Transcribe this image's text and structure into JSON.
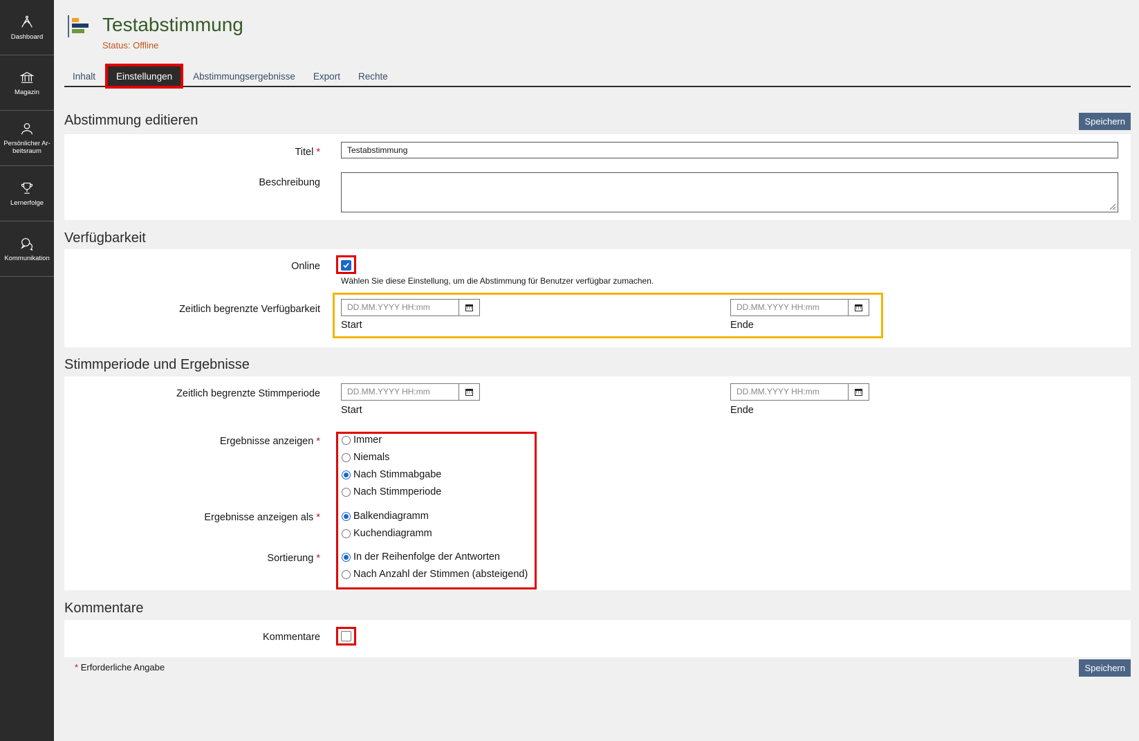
{
  "sidebar": {
    "items": [
      {
        "label": "Dashboard",
        "icon": "dashboard-icon"
      },
      {
        "label": "Magazin",
        "icon": "bank-icon"
      },
      {
        "label": "Persönlicher Ar-beitsraum",
        "icon": "user-icon"
      },
      {
        "label": "Lernerfolge",
        "icon": "trophy-icon"
      },
      {
        "label": "Kommunikation",
        "icon": "chat-icon"
      }
    ]
  },
  "header": {
    "title": "Testabstimmung",
    "status": "Status: Offline"
  },
  "tabs": [
    {
      "label": "Inhalt",
      "active": false
    },
    {
      "label": "Einstellungen",
      "active": true
    },
    {
      "label": "Abstimmungsergebnisse",
      "active": false
    },
    {
      "label": "Export",
      "active": false
    },
    {
      "label": "Rechte",
      "active": false
    }
  ],
  "buttons": {
    "save": "Speichern"
  },
  "sections": {
    "edit": "Abstimmung editieren",
    "availability": "Verfügbarkeit",
    "period": "Stimmperiode und Ergebnisse",
    "comments": "Kommentare"
  },
  "form": {
    "title_label": "Titel",
    "title_value": "Testabstimmung",
    "description_label": "Beschreibung",
    "online_label": "Online",
    "online_checked": true,
    "online_help": "Wählen Sie diese Einstellung, um die Abstimmung für Benutzer verfügbar zumachen.",
    "limited_availability_label": "Zeitlich begrenzte Verfügbarkeit",
    "limited_period_label": "Zeitlich begrenzte Stimmperiode",
    "date_placeholder": "DD.MM.YYYY HH:mm",
    "start_label": "Start",
    "end_label": "Ende",
    "show_results_label": "Ergebnisse anzeigen",
    "show_results_options": [
      "Immer",
      "Niemals",
      "Nach Stimmabgabe",
      "Nach Stimmperiode"
    ],
    "show_results_selected": "Nach Stimmabgabe",
    "show_as_label": "Ergebnisse anzeigen als",
    "show_as_options": [
      "Balkendiagramm",
      "Kuchendiagramm"
    ],
    "show_as_selected": "Balkendiagramm",
    "sort_label": "Sortierung",
    "sort_options": [
      "In der Reihenfolge der Antworten",
      "Nach Anzahl der Stimmen (absteigend)"
    ],
    "sort_selected": "In der Reihenfolge der Antworten",
    "comments_label": "Kommentare",
    "comments_checked": false,
    "required_mark": "*",
    "required_note": "Erforderliche Angabe"
  },
  "colors": {
    "accent": "#4c6586",
    "title": "#365a27",
    "status": "#c0561e",
    "highlight_red": "#e00000",
    "highlight_yellow": "#f5b400"
  }
}
